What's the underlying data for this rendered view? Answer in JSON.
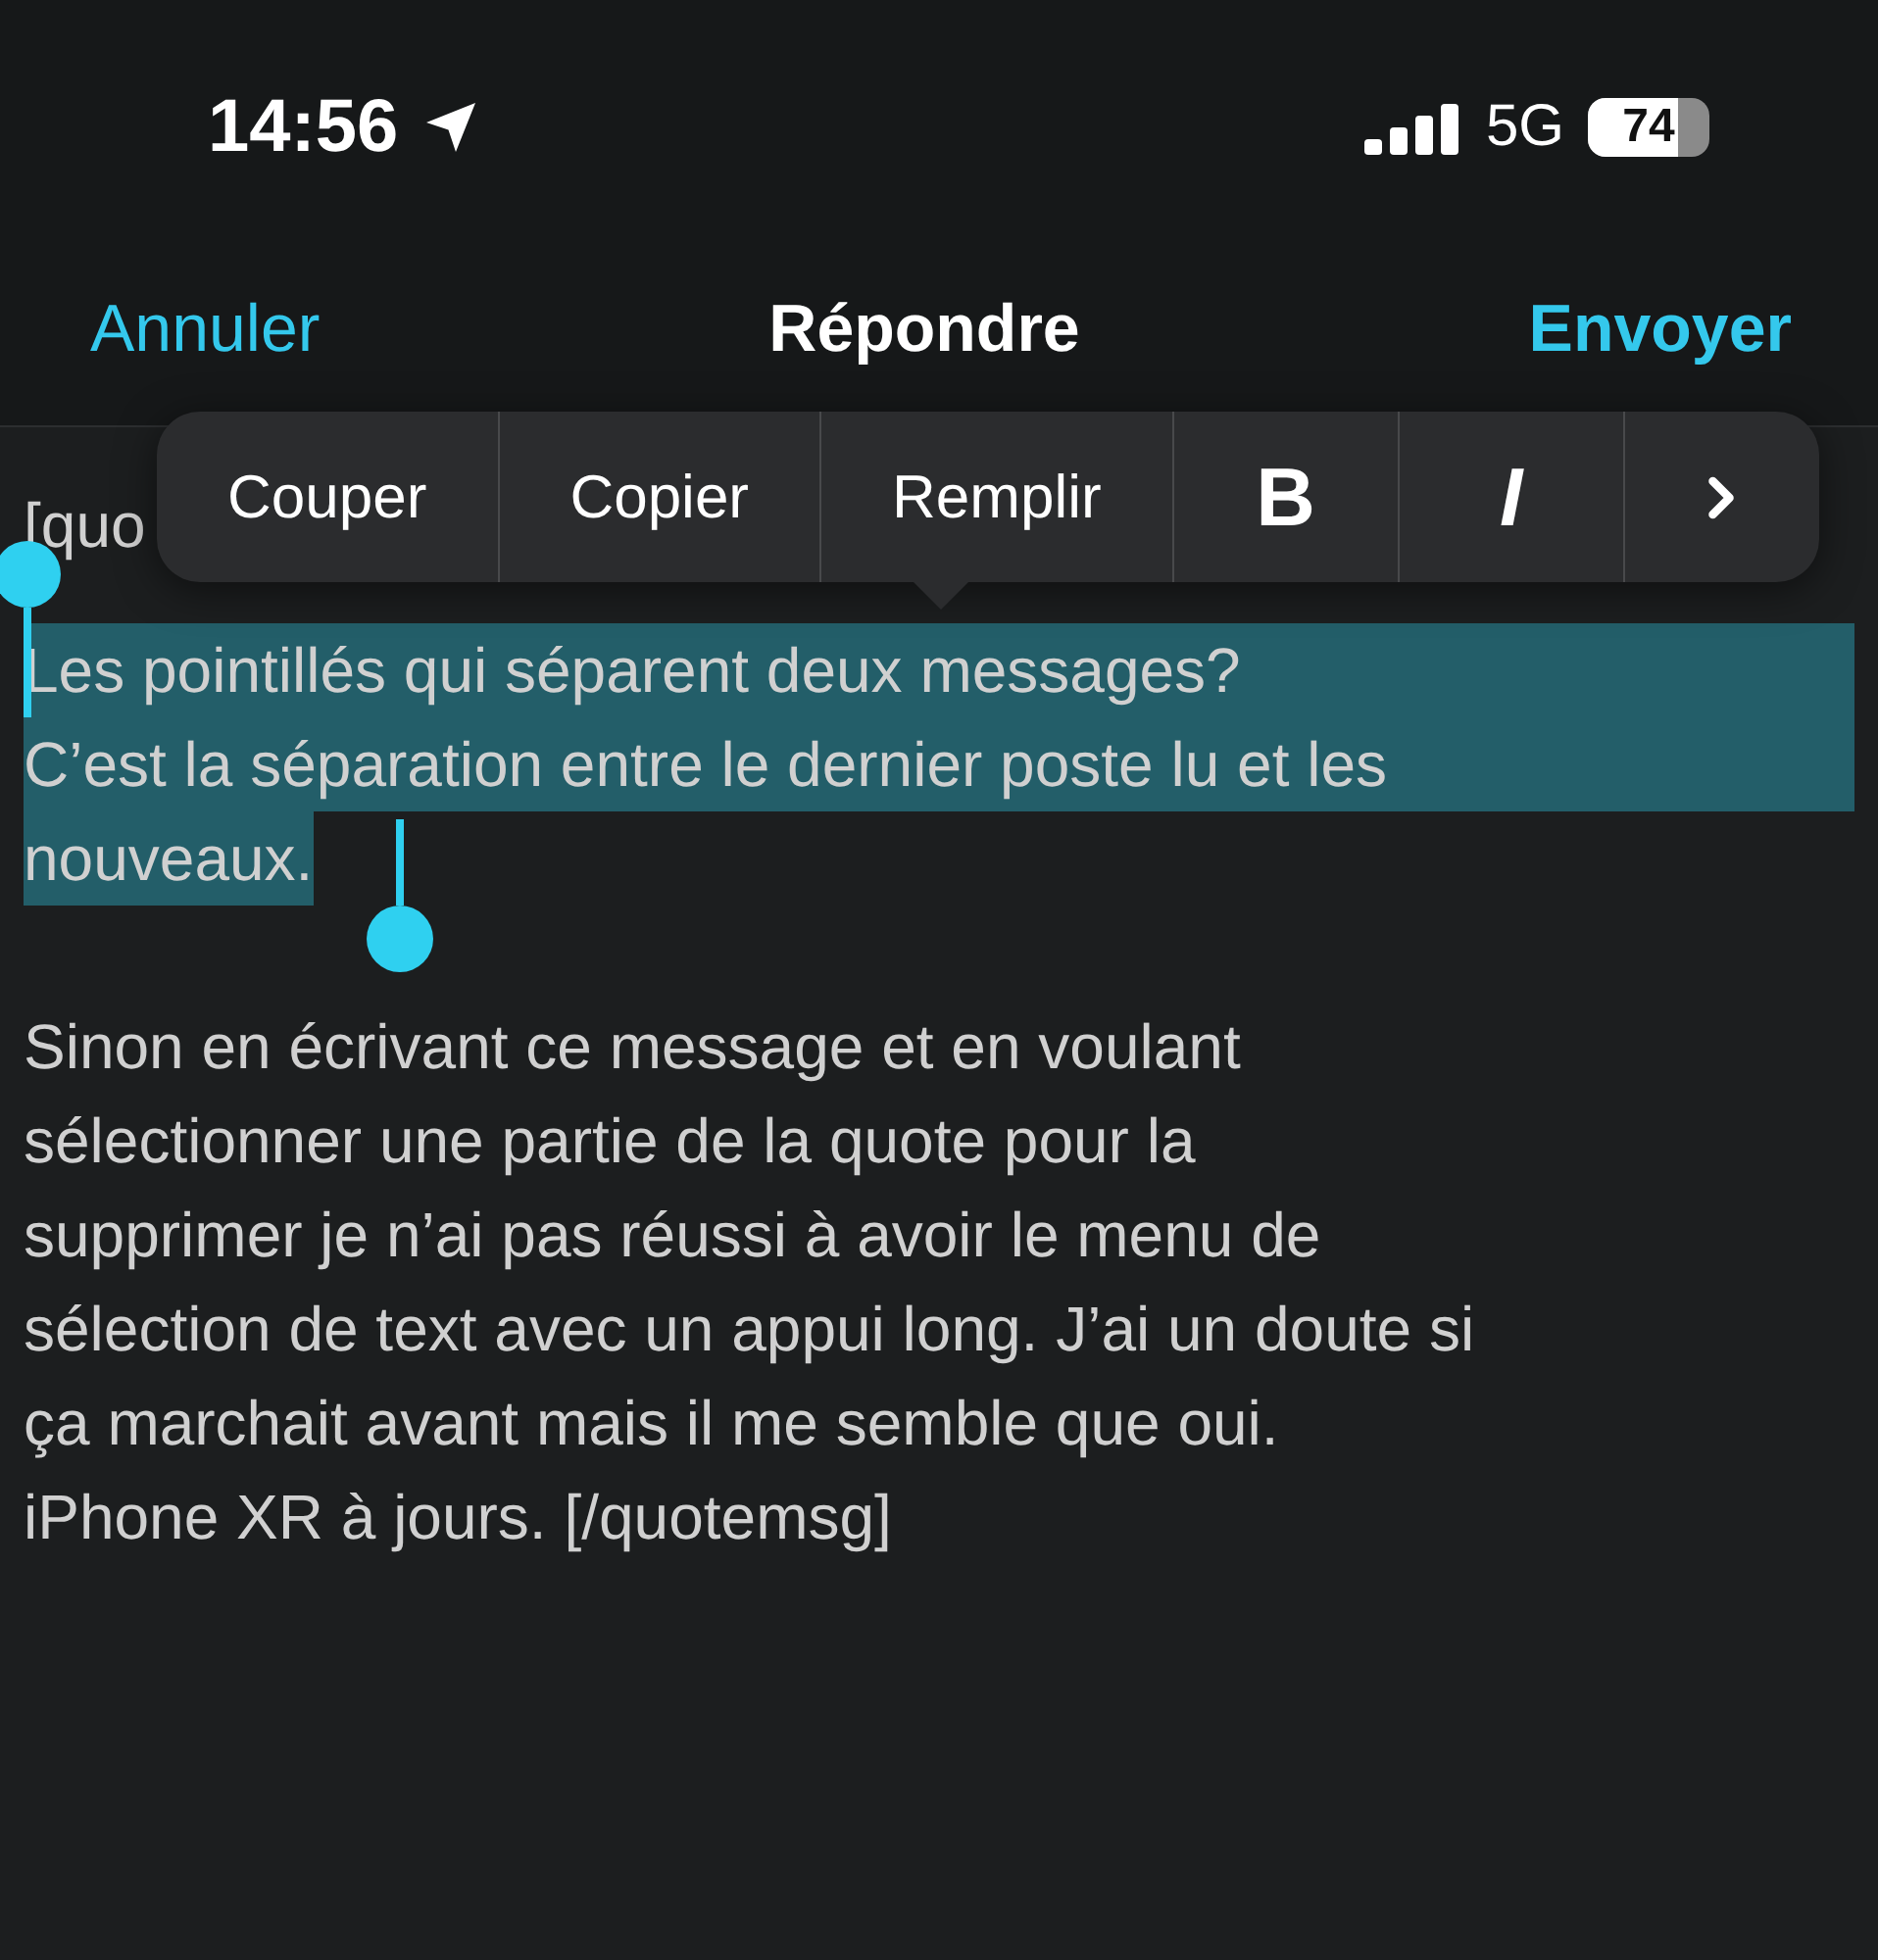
{
  "status_bar": {
    "time": "14:56",
    "network": "5G",
    "battery": "74"
  },
  "nav": {
    "cancel": "Annuler",
    "title": "Répondre",
    "send": "Envoyer"
  },
  "editor": {
    "first_line": "[quo",
    "selected_lines": [
      "Les pointillés qui séparent deux messages?",
      "C’est la séparation entre le dernier poste lu et les",
      "nouveaux."
    ],
    "paragraph_lines": [
      "Sinon en écrivant ce message et en voulant",
      "sélectionner une partie de la quote pour la",
      "supprimer je n’ai pas réussi à avoir le menu de",
      "sélection de text avec un appui long. J’ai un doute si",
      "ça marchait avant mais il me semble que oui.",
      "iPhone XR à jours. [/quotemsg]"
    ]
  },
  "edit_menu": [
    {
      "kind": "text",
      "label": "Couper"
    },
    {
      "kind": "text",
      "label": "Copier"
    },
    {
      "kind": "text",
      "label": "Remplir"
    },
    {
      "kind": "bold",
      "label": "B"
    },
    {
      "kind": "italic",
      "label": "I"
    },
    {
      "kind": "more"
    }
  ]
}
